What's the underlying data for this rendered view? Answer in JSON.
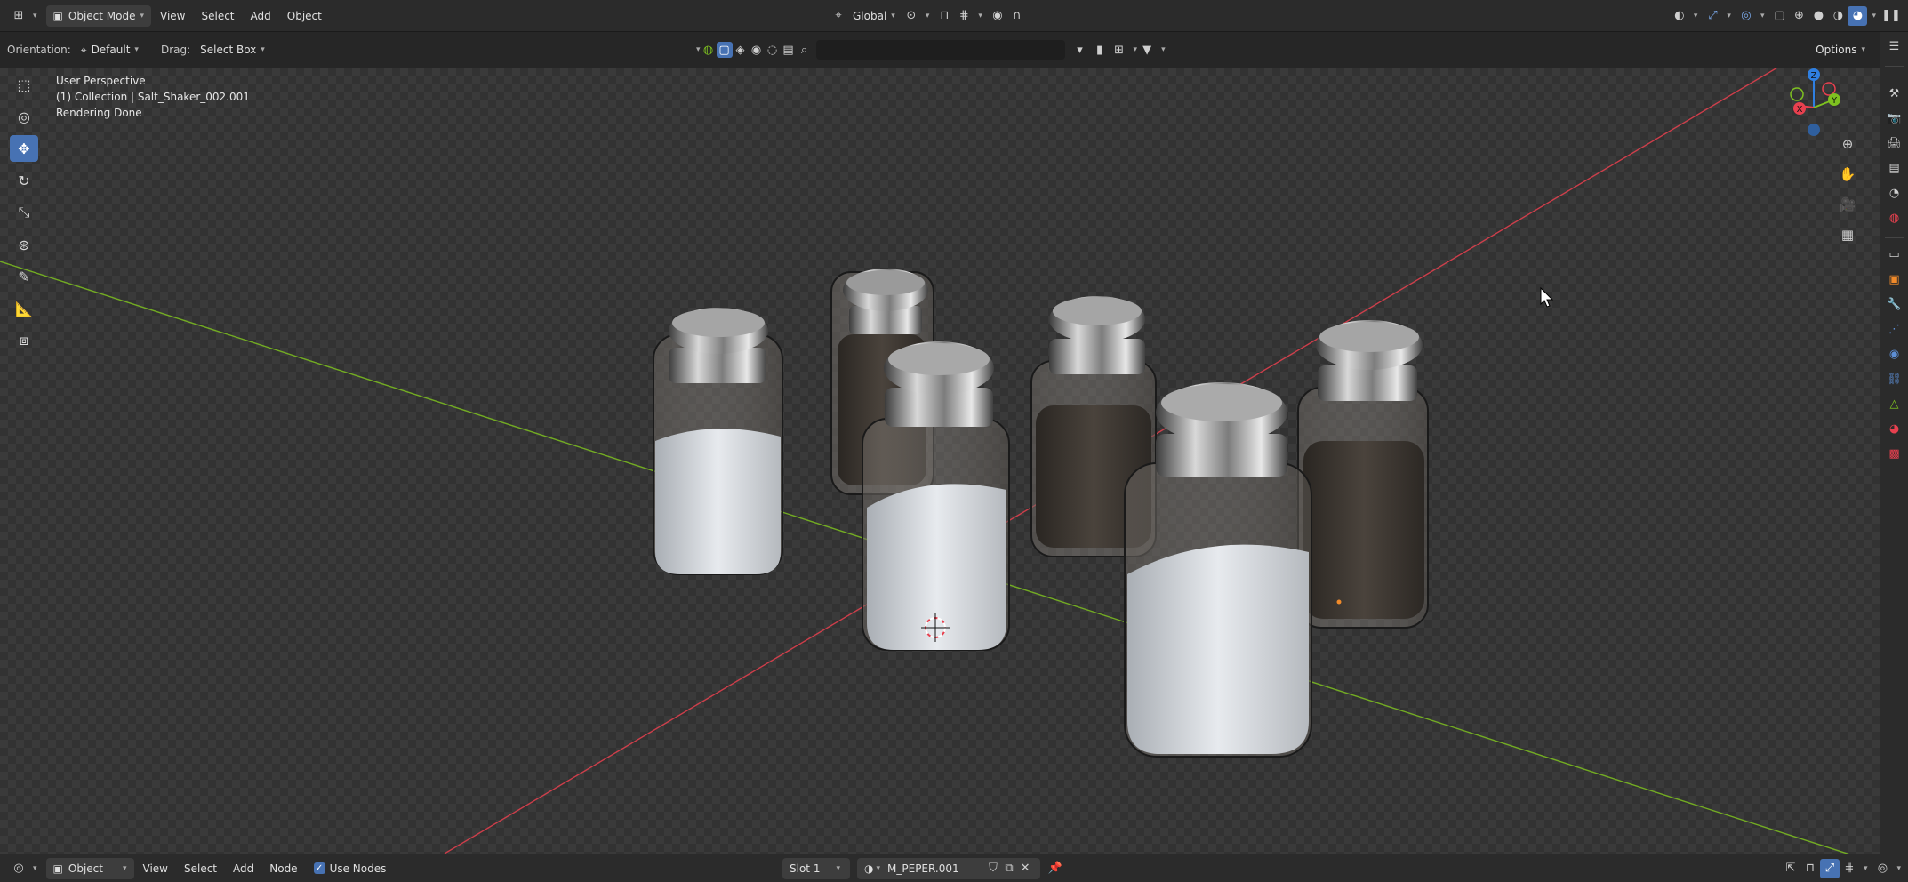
{
  "header": {
    "editor_type_icon": "3d-viewport-icon",
    "mode": "Object Mode",
    "menus": [
      "View",
      "Select",
      "Add",
      "Object"
    ],
    "orientation": "Global"
  },
  "tool_settings": {
    "orientation_label": "Orientation:",
    "orientation_value": "Default",
    "drag_label": "Drag:",
    "drag_value": "Select Box",
    "options_label": "Options"
  },
  "viewport": {
    "view_name": "User Perspective",
    "collection_info": "(1) Collection | Salt_Shaker_002.001",
    "status": "Rendering Done",
    "gizmo_labels": {
      "z": "Z",
      "x": "X",
      "y": "Y"
    }
  },
  "left_toolbar": [
    "select-box-icon",
    "cursor-icon",
    "move-icon",
    "rotate-icon",
    "scale-icon",
    "transform-icon",
    "annotate-icon",
    "measure-icon",
    "add-cube-icon"
  ],
  "properties_tabs": [
    "tool-icon",
    "render-icon",
    "output-icon",
    "view-layer-icon",
    "scene-icon",
    "world-icon",
    "collection-icon",
    "object-icon",
    "modifier-icon",
    "particles-icon",
    "physics-icon",
    "constraints-icon",
    "data-icon",
    "material-icon",
    "texture-icon"
  ],
  "bottom_bar": {
    "editor_type_icon": "node-editor-icon",
    "object_type": "Object",
    "menus": [
      "View",
      "Select",
      "Add",
      "Node"
    ],
    "use_nodes_label": "Use Nodes",
    "use_nodes_checked": true,
    "slot": "Slot 1",
    "material_name": "M_PEPER.001"
  },
  "colors": {
    "accent": "#4772b3",
    "x_axis": "#e8404f",
    "y_axis": "#7ec120",
    "z_axis": "#2f7fe0",
    "header_bg": "#2b2b2b"
  }
}
